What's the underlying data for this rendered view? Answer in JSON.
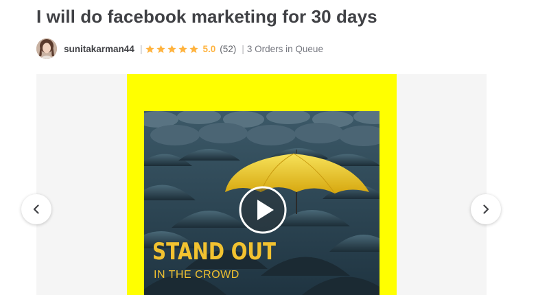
{
  "gig": {
    "title": "I will do facebook marketing for 30 days"
  },
  "seller": {
    "username": "sunitakarman44",
    "avatar_icon": "seller-avatar-photo",
    "separator": "|",
    "rating": "5.0",
    "review_count": "(52)",
    "stars": 5,
    "orders_in_queue": "3 Orders in Queue"
  },
  "gallery": {
    "background_color": "#ffff00",
    "poster_headline": "STAND OUT",
    "poster_subline": "IN THE CROWD",
    "play_icon": "play-icon",
    "prev_icon": "chevron-left-icon",
    "next_icon": "chevron-right-icon"
  },
  "colors": {
    "title": "#404145",
    "star": "#ffb33e",
    "muted": "#74767e",
    "poster_text": "#f2c230"
  }
}
